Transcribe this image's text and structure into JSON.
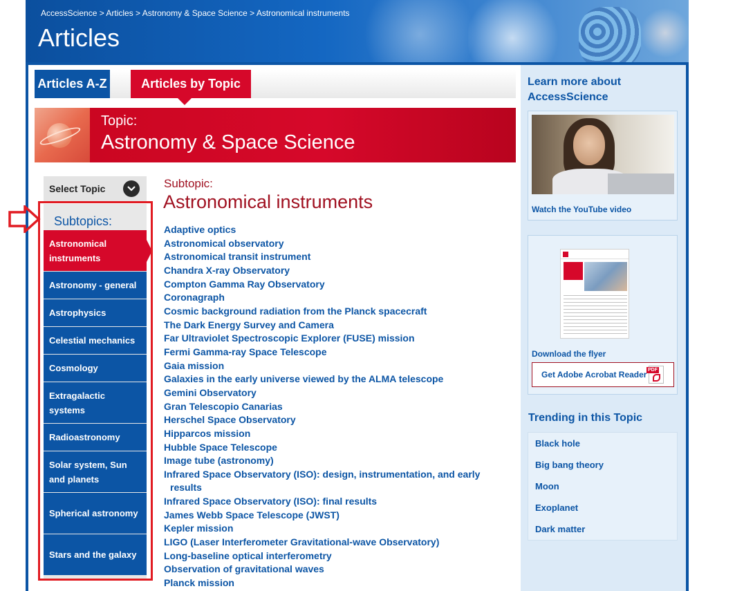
{
  "header": {
    "breadcrumb": "AccessScience > Articles > Astronomy & Space Science > Astronomical instruments",
    "title": "Articles"
  },
  "tabs": [
    {
      "label": "Articles A-Z",
      "active": false
    },
    {
      "label": "Articles by Topic",
      "active": true
    }
  ],
  "topic": {
    "label": "Topic:",
    "name": "Astronomy & Space Science"
  },
  "select_topic": {
    "label": "Select Topic"
  },
  "subtopics": {
    "heading": "Subtopics:",
    "items": [
      {
        "label": "Astronomical instruments",
        "active": true,
        "lines": 2
      },
      {
        "label": "Astronomy - general",
        "active": false,
        "lines": 1
      },
      {
        "label": "Astrophysics",
        "active": false,
        "lines": 1
      },
      {
        "label": "Celestial mechanics",
        "active": false,
        "lines": 1
      },
      {
        "label": "Cosmology",
        "active": false,
        "lines": 1
      },
      {
        "label": "Extragalactic systems",
        "active": false,
        "lines": 2
      },
      {
        "label": "Radioastronomy",
        "active": false,
        "lines": 1
      },
      {
        "label": "Solar system, Sun and planets",
        "active": false,
        "lines": 2
      },
      {
        "label": "Spherical astronomy",
        "active": false,
        "lines": 2
      },
      {
        "label": "Stars and the galaxy",
        "active": false,
        "lines": 2
      }
    ]
  },
  "content": {
    "subtopic_label": "Subtopic:",
    "subtopic_title": "Astronomical instruments",
    "articles": [
      "Adaptive optics",
      "Astronomical observatory",
      "Astronomical transit instrument",
      "Chandra X-ray Observatory",
      "Compton Gamma Ray Observatory",
      "Coronagraph",
      "Cosmic background radiation from the Planck spacecraft",
      "The Dark Energy Survey and Camera",
      "Far Ultraviolet Spectroscopic Explorer (FUSE) mission",
      "Fermi Gamma-ray Space Telescope",
      "Gaia mission",
      "Galaxies in the early universe viewed by the ALMA telescope",
      "Gemini Observatory",
      "Gran Telescopio Canarias",
      "Herschel Space Observatory",
      "Hipparcos mission",
      "Hubble Space Telescope",
      "Image tube (astronomy)",
      "Infrared Space Observatory (ISO): design, instrumentation, and early results",
      "Infrared Space Observatory (ISO): final results",
      "James Webb Space Telescope (JWST)",
      "Kepler mission",
      "LIGO (Laser Interferometer Gravitational-wave Observatory)",
      "Long-baseline optical interferometry",
      "Observation of gravitational waves",
      "Planck mission"
    ]
  },
  "sidebar": {
    "learn_more": "Learn more about AccessScience",
    "video_caption": "Watch the YouTube video",
    "flyer_caption": "Download the flyer",
    "acrobat_label": "Get Adobe Acrobat Reader",
    "pdf_tag": "PDF",
    "trending_heading": "Trending in this Topic",
    "trending": [
      "Black hole",
      "Big bang theory",
      "Moon",
      "Exoplanet",
      "Dark matter"
    ]
  },
  "colors": {
    "brand_blue": "#0c55a5",
    "brand_red": "#d6082a",
    "heading_red": "#a01020",
    "annotation_red": "#e11b22"
  }
}
